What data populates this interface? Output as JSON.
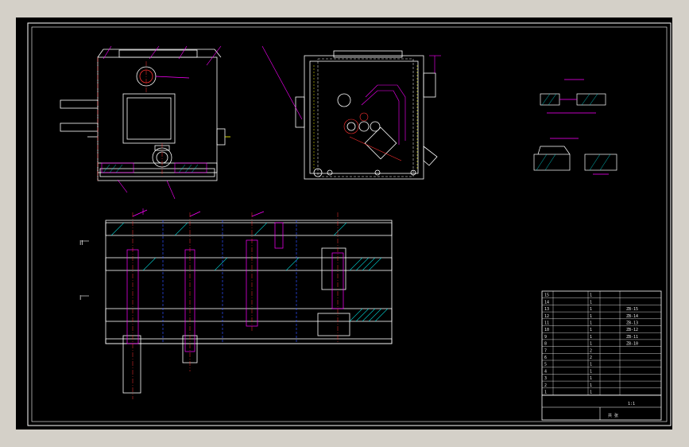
{
  "drawing": {
    "section_labels": {
      "upper": "II",
      "lower": "I"
    },
    "title_block": {
      "scale_text": "1:1",
      "sheet_text": "共  张",
      "parts_rows": [
        {
          "no": "15",
          "qty": "1",
          "code": ""
        },
        {
          "no": "14",
          "qty": "1",
          "code": ""
        },
        {
          "no": "13",
          "qty": "1",
          "code": "ZB-15"
        },
        {
          "no": "12",
          "qty": "1",
          "code": "ZB-14"
        },
        {
          "no": "11",
          "qty": "1",
          "code": "ZB-13"
        },
        {
          "no": "10",
          "qty": "1",
          "code": "ZB-12"
        },
        {
          "no": "9",
          "qty": "1",
          "code": "ZB-11"
        },
        {
          "no": "8",
          "qty": "1",
          "code": "ZB-10"
        },
        {
          "no": "7",
          "qty": "2",
          "code": ""
        },
        {
          "no": "6",
          "qty": "2",
          "code": ""
        },
        {
          "no": "5",
          "qty": "1",
          "code": ""
        },
        {
          "no": "4",
          "qty": "1",
          "code": ""
        },
        {
          "no": "3",
          "qty": "1",
          "code": ""
        },
        {
          "no": "2",
          "qty": "1",
          "code": ""
        },
        {
          "no": "1",
          "qty": "1",
          "code": ""
        }
      ]
    },
    "colors": {
      "background": "#000000",
      "outline": "#ffffff",
      "dimension": "#ff00ff",
      "hatch": "#00c8c8",
      "center": "#ff3030",
      "hidden": "#3050ff",
      "accent": "#ffff00"
    }
  }
}
